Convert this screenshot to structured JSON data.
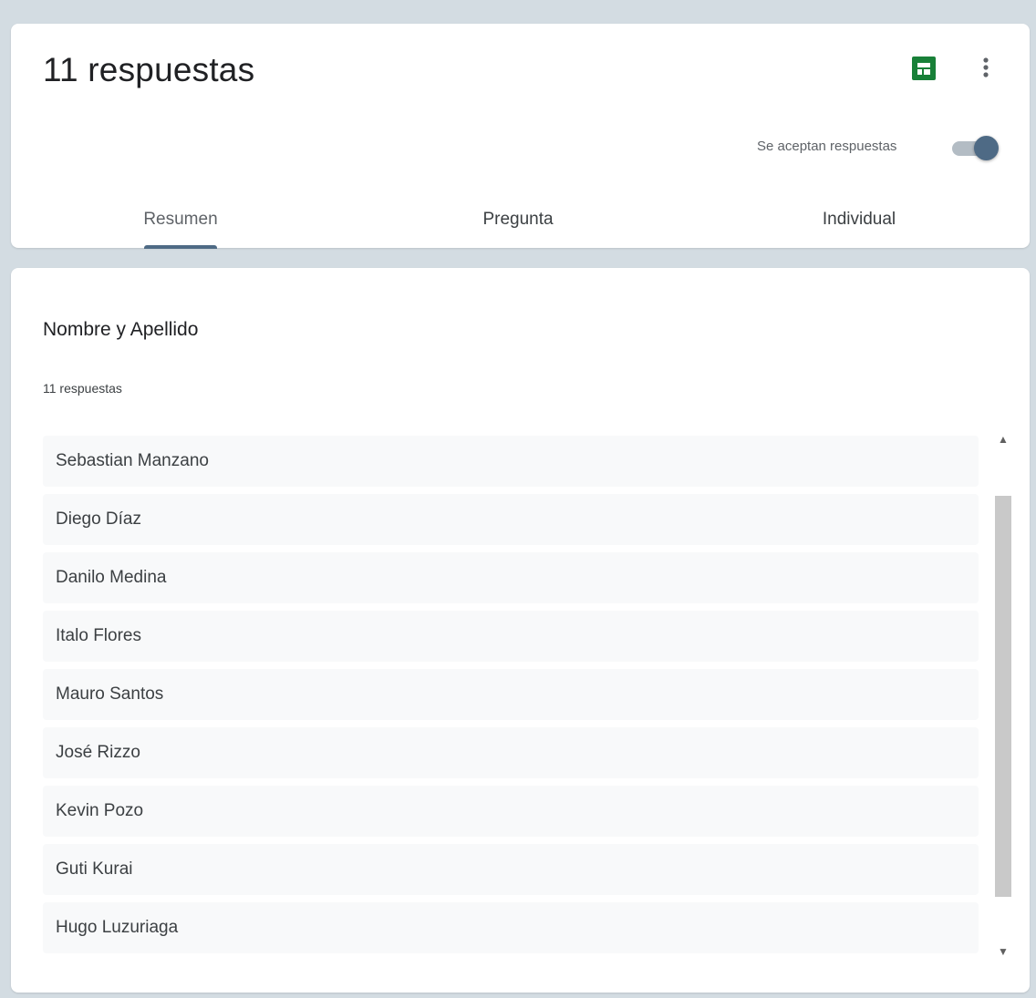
{
  "header": {
    "title": "11 respuestas",
    "accepting_label": "Se aceptan respuestas",
    "accepting_enabled": true,
    "icons": [
      "sheets-icon",
      "more-vert-icon"
    ],
    "colors": {
      "accent": "#4e6a85",
      "sheets_green": "#188038"
    }
  },
  "tabs": [
    {
      "label": "Resumen",
      "selected": true
    },
    {
      "label": "Pregunta",
      "selected": false
    },
    {
      "label": "Individual",
      "selected": false
    }
  ],
  "question": {
    "title": "Nombre y Apellido",
    "count_label": "11 respuestas",
    "responses": [
      "Sebastian Manzano",
      "Diego Díaz",
      "Danilo Medina",
      "Italo Flores",
      "Mauro Santos",
      "José Rizzo",
      "Kevin Pozo",
      "Guti Kurai",
      "Hugo Luzuriaga"
    ]
  }
}
